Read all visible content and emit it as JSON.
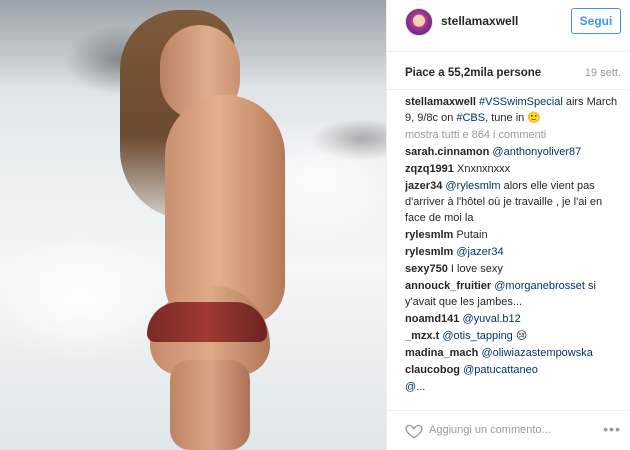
{
  "header": {
    "username": "stellamaxwell",
    "follow_label": "Segui"
  },
  "stats": {
    "likes": "Piace a 55,2mila persone",
    "time": "19 sett."
  },
  "caption": {
    "user": "stellamaxwell",
    "mention1": "#VSSwimSpecial",
    "text1": " airs March 9, 9/8c on ",
    "mention2": "#CBS",
    "text2": ", tune in 🙂"
  },
  "more_comments": "mostra tutti e 864 i commenti",
  "comments": [
    {
      "user": "sarah.cinnamon",
      "mention": "@anthonyoliver87",
      "text": ""
    },
    {
      "user": "zqzq1991",
      "mention": "",
      "text": "Xnxnxnxxx"
    },
    {
      "user": "jazer34",
      "mention": "@rylesmlm",
      "text": " alors elle vient pas d'arriver à l'hôtel où je travaille , je l'ai en face de moi la"
    },
    {
      "user": "rylesmlm",
      "mention": "",
      "text": "Putain"
    },
    {
      "user": "rylesmlm",
      "mention": "@jazer34",
      "text": ""
    },
    {
      "user": "sexy750",
      "mention": "",
      "text": "I love sexy"
    },
    {
      "user": "annouck_fruitier",
      "mention": "@morganebrosset",
      "text": " si y'avait que les jambes..."
    },
    {
      "user": "noamd141",
      "mention": "@yuval.b12",
      "text": ""
    },
    {
      "user": "_mzx.t",
      "mention": "@otis_tapping",
      "text": " 😢"
    },
    {
      "user": "madina_mach",
      "mention": "@oliwiazastempowska",
      "text": ""
    },
    {
      "user": "claucobog",
      "mention": "@patucattaneo",
      "text": ""
    },
    {
      "user": "",
      "mention": "@...",
      "text": ""
    }
  ],
  "add_comment": {
    "placeholder": "Aggiungi un commento...",
    "more_label": "•••"
  },
  "icons": {
    "like": "heart-icon",
    "more": "more-icon"
  },
  "colors": {
    "link": "#003569",
    "follow": "#3897f0",
    "muted": "#999999"
  }
}
